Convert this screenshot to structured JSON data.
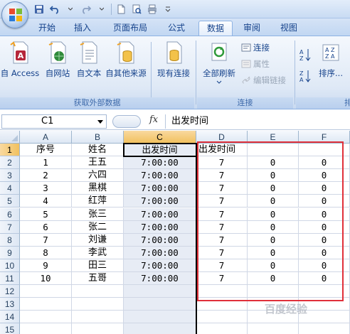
{
  "quick_access": {
    "icons": [
      "save-icon",
      "undo-icon",
      "redo-icon",
      "new-doc-icon",
      "print-preview-icon",
      "customize-icon"
    ]
  },
  "tabs": [
    "开始",
    "插入",
    "页面布局",
    "公式",
    "数据",
    "审阅",
    "视图"
  ],
  "active_tab": "数据",
  "ribbon": {
    "external_data": {
      "label": "获取外部数据",
      "buttons": [
        "自 Access",
        "自网站",
        "自文本",
        "自其他来源",
        "现有连接"
      ]
    },
    "connections": {
      "label": "连接",
      "refresh": "全部刷新",
      "links": [
        "连接",
        "属性",
        "编辑链接"
      ]
    },
    "sort": {
      "label": "排",
      "sort_button": "排序..."
    }
  },
  "formula_bar": {
    "name_box": "C1",
    "fx": "fx",
    "content": "出发时间"
  },
  "sheet": {
    "columns": [
      "A",
      "B",
      "C",
      "D",
      "E",
      "F"
    ],
    "row_numbers": [
      "1",
      "2",
      "3",
      "4",
      "5",
      "6",
      "7",
      "8",
      "9",
      "10",
      "11",
      "12",
      "13",
      "14",
      "15"
    ],
    "header": [
      "序号",
      "姓名",
      "出发时间",
      "出发时间",
      "",
      ""
    ],
    "rows": [
      [
        "1",
        "王五",
        "7:00:00",
        "7",
        "0",
        "0"
      ],
      [
        "2",
        "六四",
        "7:00:00",
        "7",
        "0",
        "0"
      ],
      [
        "3",
        "黑棋",
        "7:00:00",
        "7",
        "0",
        "0"
      ],
      [
        "4",
        "红萍",
        "7:00:00",
        "7",
        "0",
        "0"
      ],
      [
        "5",
        "张三",
        "7:00:00",
        "7",
        "0",
        "0"
      ],
      [
        "6",
        "张二",
        "7:00:00",
        "7",
        "0",
        "0"
      ],
      [
        "7",
        "刘谦",
        "7:00:00",
        "7",
        "0",
        "0"
      ],
      [
        "8",
        "李武",
        "7:00:00",
        "7",
        "0",
        "0"
      ],
      [
        "9",
        "田三",
        "7:00:00",
        "7",
        "0",
        "0"
      ],
      [
        "10",
        "五哥",
        "7:00:00",
        "7",
        "0",
        "0"
      ]
    ],
    "selected_cell": "C1"
  },
  "watermark": "百度经验",
  "colors": {
    "accent": "#15428b",
    "highlight_box": "#e0303a",
    "selected_header": "#f1c15f"
  }
}
